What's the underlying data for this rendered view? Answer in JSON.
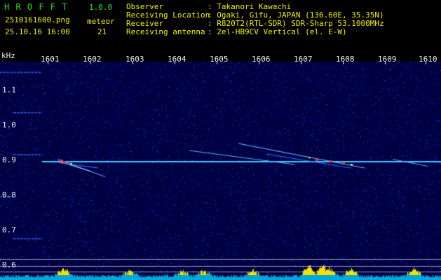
{
  "header": {
    "app_title": "H R O F F T",
    "version": "1.0.0",
    "filename": "2510161600.png",
    "timestamp": "25.10.16 16:00",
    "counter_label": "meteor",
    "counter_value": "21"
  },
  "station_info": [
    {
      "label": "Observer",
      "value": ": Takanori Kawachi"
    },
    {
      "label": "Receiving Location",
      "value": ": Ogaki, Gifu, JAPAN (136.60E, 35.35N)"
    },
    {
      "label": "Receiver",
      "value": ": R820T2(RTL-SDR) SDR-Sharp 53.1000MHz"
    },
    {
      "label": "Receiving antenna",
      "value": ": 2el-HB9CV Vertical (el. E-W)"
    }
  ],
  "axes": {
    "y_unit": "kHz",
    "x_ticks": [
      "1601",
      "1602",
      "1603",
      "1604",
      "1605",
      "1606",
      "1607",
      "1608",
      "1609",
      "1610"
    ],
    "y_ticks": [
      "1.1",
      "1.0",
      "0.9",
      "0.8",
      "0.7",
      "0.6"
    ]
  },
  "colors": {
    "text_green": "#22e022",
    "text_yellow": "#f0f000",
    "background": "#000000",
    "noise_floor": "#0a0a6e",
    "carrier": "#40c8ff",
    "echo_hot": "#ff3030",
    "activity_fill_low": "#00a8d8",
    "activity_fill_high": "#f8e000"
  }
}
